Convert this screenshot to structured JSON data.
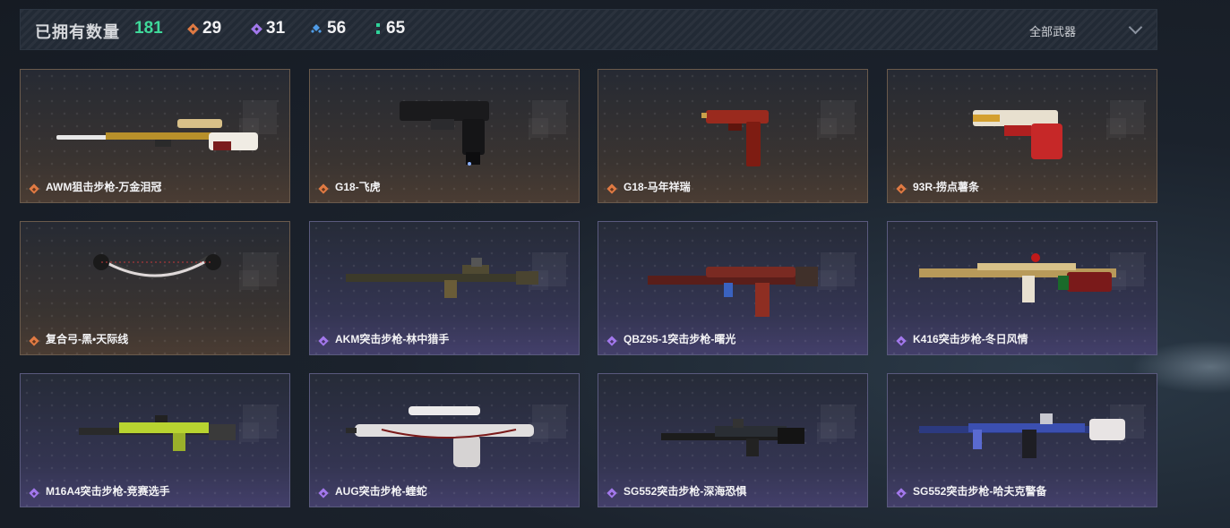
{
  "header": {
    "owned_label": "已拥有数量",
    "owned_count": "181",
    "stats": [
      {
        "icon": "orange-diamond-icon",
        "color": "#e07a43",
        "value": "29"
      },
      {
        "icon": "purple-diamond-icon",
        "color": "#a278ec",
        "value": "31"
      },
      {
        "icon": "blue-diamond-icon",
        "color": "#4f9be6",
        "value": "56"
      },
      {
        "icon": "green-dots-icon",
        "color": "#2fd39a",
        "value": "65"
      }
    ],
    "filter_label": "全部武器"
  },
  "rarity_colors": {
    "orange": "#e07a43",
    "purple": "#a278ec"
  },
  "weapons": [
    {
      "name": "AWM狙击步枪-万金泪冠",
      "rarity": "orange"
    },
    {
      "name": "G18-飞虎",
      "rarity": "orange"
    },
    {
      "name": "G18-马年祥瑞",
      "rarity": "orange"
    },
    {
      "name": "93R-捞点薯条",
      "rarity": "orange"
    },
    {
      "name": "复合弓-黑•天际线",
      "rarity": "orange"
    },
    {
      "name": "AKM突击步枪-林中猎手",
      "rarity": "purple"
    },
    {
      "name": "QBZ95-1突击步枪-曙光",
      "rarity": "purple"
    },
    {
      "name": "K416突击步枪-冬日风情",
      "rarity": "purple"
    },
    {
      "name": "M16A4突击步枪-竞赛选手",
      "rarity": "purple"
    },
    {
      "name": "AUG突击步枪-蝰蛇",
      "rarity": "purple"
    },
    {
      "name": "SG552突击步枪-深海恐惧",
      "rarity": "purple"
    },
    {
      "name": "SG552突击步枪-哈夫克警备",
      "rarity": "purple"
    }
  ]
}
